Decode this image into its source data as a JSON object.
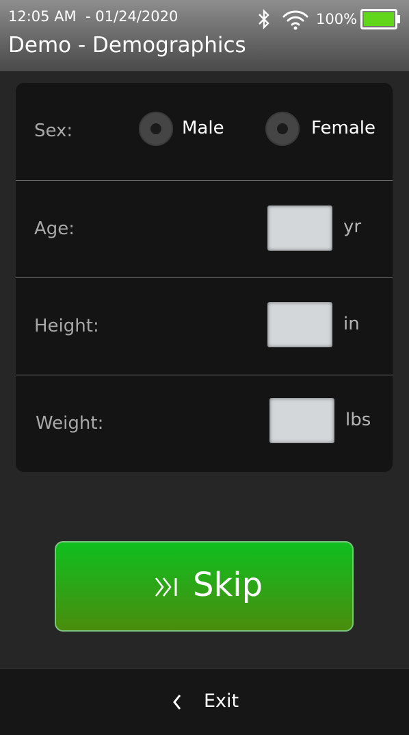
{
  "status_bar": {
    "time_date": "12:05 AM  - 01/24/2020",
    "battery_percent": "100%",
    "battery_level": 1.0,
    "battery_color": "#62d61a",
    "icons": [
      "bluetooth-icon",
      "wifi-icon",
      "battery-icon"
    ]
  },
  "header": {
    "title": "Demo - Demographics"
  },
  "form": {
    "sex": {
      "label": "Sex:",
      "options": [
        "Male",
        "Female"
      ],
      "selected": null
    },
    "age": {
      "label": "Age:",
      "value": "",
      "unit": "yr"
    },
    "height": {
      "label": "Height:",
      "value": "",
      "unit": "in"
    },
    "weight": {
      "label": "Weight:",
      "value": "",
      "unit": "lbs"
    }
  },
  "skip_button": {
    "label": "Skip",
    "icon": "skip-forward-icon",
    "color": "#1fb11a"
  },
  "footer": {
    "exit_label": "Exit",
    "icon": "chevron-left-icon"
  }
}
